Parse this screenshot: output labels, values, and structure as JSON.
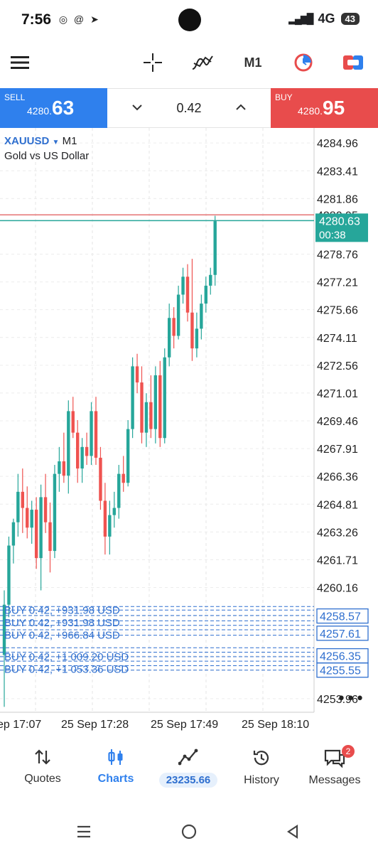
{
  "status": {
    "time": "7:56",
    "network": "4G",
    "battery": "43"
  },
  "toolbar": {
    "timeframe": "M1"
  },
  "trade": {
    "sell_label": "SELL",
    "sell_price_main": "4280.",
    "sell_price_big": "63",
    "buy_label": "BUY",
    "buy_price_main": "4280.",
    "buy_price_big": "95",
    "volume": "0.42"
  },
  "chart": {
    "symbol": "XAUUSD",
    "timeframe": "M1",
    "subtitle": "Gold vs US Dollar",
    "price_levels": [
      "4284.96",
      "4283.41",
      "4281.86",
      "4280.95",
      "4278.76",
      "4277.21",
      "4275.66",
      "4274.11",
      "4272.56",
      "4271.01",
      "4269.46",
      "4267.91",
      "4266.36",
      "4264.81",
      "4263.26",
      "4261.71",
      "4260.16",
      "4258.57",
      "4257.61",
      "4256.35",
      "4255.55",
      "4253.96"
    ],
    "current_price": "4280.63",
    "countdown": "00:38",
    "time_labels": [
      "ep 17:07",
      "25 Sep 17:28",
      "25 Sep 17:49",
      "25 Sep 18:10"
    ],
    "positions": [
      "BUY 0.42, +931.98 USD",
      "BUY 0.42, +966.84 USD",
      "BUY 0.42, +1 053.36 USD",
      "BUY 0.42, +1 009.20 USD"
    ],
    "colors": {
      "bull": "#26a69a",
      "bear": "#ef5350",
      "bid": "#26a69a",
      "ask": "#e57373",
      "position": "#2f6fcf"
    }
  },
  "chart_data": {
    "type": "candlestick",
    "symbol": "XAUUSD",
    "timeframe": "M1",
    "ylim": [
      4253.2,
      4285.8
    ],
    "candles": [
      {
        "o": 4256.4,
        "h": 4260.0,
        "l": 4253.5,
        "c": 4259.2
      },
      {
        "o": 4259.2,
        "h": 4263.0,
        "l": 4258.5,
        "c": 4262.5
      },
      {
        "o": 4262.5,
        "h": 4264.0,
        "l": 4261.5,
        "c": 4263.8
      },
      {
        "o": 4263.8,
        "h": 4266.5,
        "l": 4263.0,
        "c": 4265.5
      },
      {
        "o": 4265.5,
        "h": 4266.8,
        "l": 4263.2,
        "c": 4264.6
      },
      {
        "o": 4264.6,
        "h": 4265.8,
        "l": 4262.9,
        "c": 4263.5
      },
      {
        "o": 4263.5,
        "h": 4265.0,
        "l": 4262.6,
        "c": 4264.5
      },
      {
        "o": 4264.5,
        "h": 4265.2,
        "l": 4261.2,
        "c": 4261.8
      },
      {
        "o": 4261.8,
        "h": 4265.9,
        "l": 4260.0,
        "c": 4265.2
      },
      {
        "o": 4265.2,
        "h": 4266.5,
        "l": 4263.2,
        "c": 4263.8
      },
      {
        "o": 4263.8,
        "h": 4264.9,
        "l": 4261.0,
        "c": 4262.2
      },
      {
        "o": 4262.2,
        "h": 4267.0,
        "l": 4261.8,
        "c": 4266.5
      },
      {
        "o": 4266.5,
        "h": 4268.0,
        "l": 4265.5,
        "c": 4267.2
      },
      {
        "o": 4267.2,
        "h": 4268.8,
        "l": 4266.0,
        "c": 4266.4
      },
      {
        "o": 4266.4,
        "h": 4270.6,
        "l": 4265.4,
        "c": 4270.0
      },
      {
        "o": 4270.0,
        "h": 4270.8,
        "l": 4268.5,
        "c": 4268.8
      },
      {
        "o": 4268.8,
        "h": 4269.5,
        "l": 4266.0,
        "c": 4266.8
      },
      {
        "o": 4266.8,
        "h": 4268.5,
        "l": 4266.0,
        "c": 4268.0
      },
      {
        "o": 4268.0,
        "h": 4268.8,
        "l": 4267.0,
        "c": 4267.5
      },
      {
        "o": 4267.5,
        "h": 4270.5,
        "l": 4267.0,
        "c": 4270.0
      },
      {
        "o": 4270.0,
        "h": 4270.8,
        "l": 4267.0,
        "c": 4267.4
      },
      {
        "o": 4267.4,
        "h": 4268.0,
        "l": 4264.5,
        "c": 4265.0
      },
      {
        "o": 4265.0,
        "h": 4266.0,
        "l": 4262.0,
        "c": 4263.0
      },
      {
        "o": 4263.0,
        "h": 4265.0,
        "l": 4262.0,
        "c": 4264.2
      },
      {
        "o": 4264.2,
        "h": 4265.5,
        "l": 4263.5,
        "c": 4264.6
      },
      {
        "o": 4264.6,
        "h": 4267.0,
        "l": 4264.0,
        "c": 4266.5
      },
      {
        "o": 4266.5,
        "h": 4267.5,
        "l": 4265.5,
        "c": 4266.0
      },
      {
        "o": 4266.0,
        "h": 4269.5,
        "l": 4265.8,
        "c": 4269.0
      },
      {
        "o": 4269.0,
        "h": 4273.0,
        "l": 4268.5,
        "c": 4272.5
      },
      {
        "o": 4272.5,
        "h": 4273.2,
        "l": 4271.0,
        "c": 4271.6
      },
      {
        "o": 4271.6,
        "h": 4272.5,
        "l": 4268.2,
        "c": 4268.8
      },
      {
        "o": 4268.8,
        "h": 4271.0,
        "l": 4268.0,
        "c": 4270.5
      },
      {
        "o": 4270.5,
        "h": 4272.0,
        "l": 4268.5,
        "c": 4269.0
      },
      {
        "o": 4269.0,
        "h": 4272.5,
        "l": 4268.2,
        "c": 4272.0
      },
      {
        "o": 4272.0,
        "h": 4272.8,
        "l": 4268.0,
        "c": 4268.5
      },
      {
        "o": 4268.5,
        "h": 4273.5,
        "l": 4268.2,
        "c": 4273.0
      },
      {
        "o": 4273.0,
        "h": 4276.0,
        "l": 4272.5,
        "c": 4275.2
      },
      {
        "o": 4275.2,
        "h": 4275.8,
        "l": 4273.5,
        "c": 4274.2
      },
      {
        "o": 4274.2,
        "h": 4277.0,
        "l": 4274.0,
        "c": 4276.5
      },
      {
        "o": 4276.5,
        "h": 4278.0,
        "l": 4276.0,
        "c": 4277.5
      },
      {
        "o": 4277.5,
        "h": 4278.2,
        "l": 4275.0,
        "c": 4275.5
      },
      {
        "o": 4275.5,
        "h": 4278.5,
        "l": 4272.8,
        "c": 4273.5
      },
      {
        "o": 4273.5,
        "h": 4275.5,
        "l": 4273.0,
        "c": 4274.6
      },
      {
        "o": 4274.6,
        "h": 4276.5,
        "l": 4274.0,
        "c": 4276.0
      },
      {
        "o": 4276.0,
        "h": 4277.5,
        "l": 4275.5,
        "c": 4277.0
      },
      {
        "o": 4277.0,
        "h": 4278.0,
        "l": 4276.5,
        "c": 4277.6
      },
      {
        "o": 4277.6,
        "h": 4280.9,
        "l": 4277.0,
        "c": 4280.6
      }
    ]
  }
}
